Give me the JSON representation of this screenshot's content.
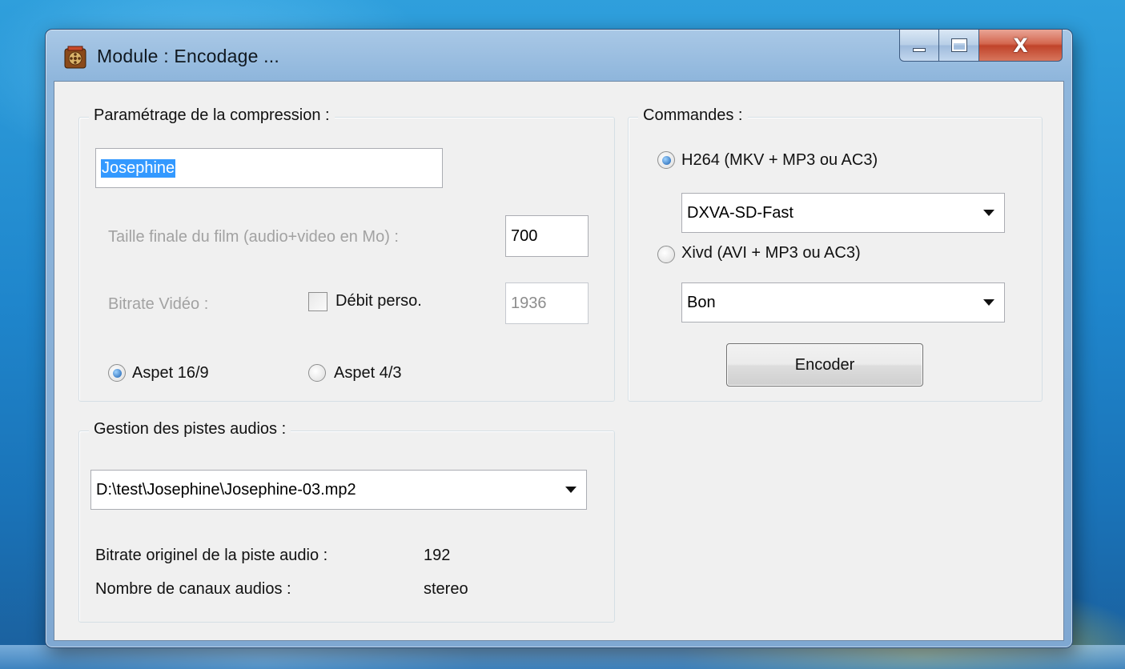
{
  "window": {
    "title": "Module : Encodage ...",
    "icon": "film-reel-icon",
    "controls": {
      "minimize": "minimize",
      "maximize": "maximize",
      "close": "X"
    }
  },
  "compression": {
    "group_label": "Paramétrage de la compression :",
    "name_value": "Josephine",
    "final_size_label": "Taille finale du film (audio+video en Mo) :",
    "final_size_value": "700",
    "bitrate_label": "Bitrate Vidéo :",
    "custom_bitrate_label": "Débit perso.",
    "custom_bitrate_checked": false,
    "bitrate_value": "1936",
    "aspect_16_9_label": "Aspet 16/9",
    "aspect_4_3_label": "Aspet 4/3",
    "aspect_selected": "16/9"
  },
  "audio": {
    "group_label": "Gestion des pistes audios :",
    "track_selected": "D:\\test\\Josephine\\Josephine-03.mp2",
    "orig_bitrate_label": "Bitrate originel de la piste audio :",
    "orig_bitrate_value": "192",
    "channels_label": "Nombre de canaux audios :",
    "channels_value": "stereo"
  },
  "commands": {
    "group_label": "Commandes :",
    "h264_label": "H264 (MKV + MP3 ou AC3)",
    "h264_selected": true,
    "h264_preset": "DXVA-SD-Fast",
    "xvid_label": "Xivd (AVI + MP3 ou AC3)",
    "xvid_preset": "Bon",
    "encode_button": "Encoder"
  },
  "colors": {
    "desktop": "#1f86cc",
    "selection": "#3399ff",
    "close_button": "#c0432a"
  }
}
